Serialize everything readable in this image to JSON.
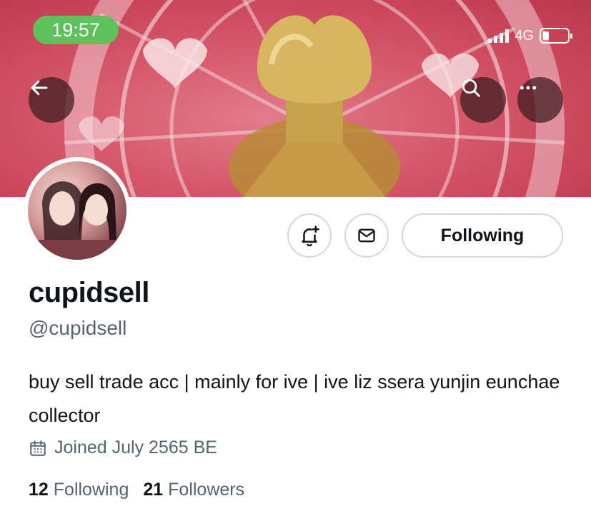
{
  "status_bar": {
    "time": "19:57",
    "network": "4G"
  },
  "header": {
    "back_icon": "arrow-left-icon",
    "search_icon": "search-icon",
    "more_icon": "more-horizontal-icon"
  },
  "actions": {
    "notify_icon": "bell-plus-icon",
    "message_icon": "envelope-icon",
    "following_label": "Following"
  },
  "profile": {
    "display_name": "cupidsell",
    "handle": "@cupidsell",
    "bio": "buy sell trade acc | mainly for ive | ive liz ssera yunjin eunchae collector",
    "joined": "Joined July 2565 BE"
  },
  "stats": {
    "following_count": "12",
    "following_label": "Following",
    "followers_count": "21",
    "followers_label": "Followers"
  },
  "colors": {
    "accent_status": "#5fc15c",
    "muted_text": "#536471",
    "border": "#cfd9de"
  }
}
